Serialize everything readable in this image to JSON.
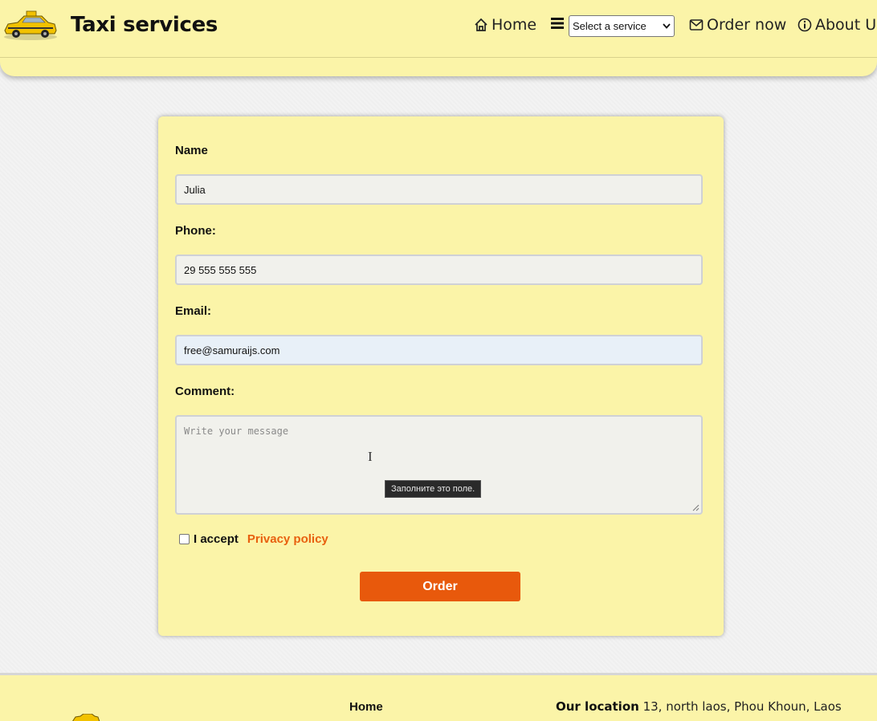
{
  "header": {
    "brand": "Taxi services",
    "nav": {
      "home": "Home",
      "service_select": "Select a service",
      "order": "Order now",
      "about": "About Us"
    }
  },
  "form": {
    "name_label": "Name",
    "name_value": "Julia",
    "phone_label": "Phone:",
    "phone_value": "29 555 555 555",
    "email_label": "Email:",
    "email_value": "free@samuraijs.com",
    "comment_label": "Comment:",
    "comment_placeholder": "Write your message",
    "tooltip": "Заполните это поле.",
    "accept_label": "I accept",
    "privacy_link": "Privacy policy",
    "submit": "Order"
  },
  "footer": {
    "home": "Home",
    "location_label": "Our location",
    "location_value": "13, north laos, Phou Khoun, Laos"
  },
  "colors": {
    "header_bg": "#fbf4a8",
    "accent": "#e8590c",
    "link": "#e8600f"
  }
}
